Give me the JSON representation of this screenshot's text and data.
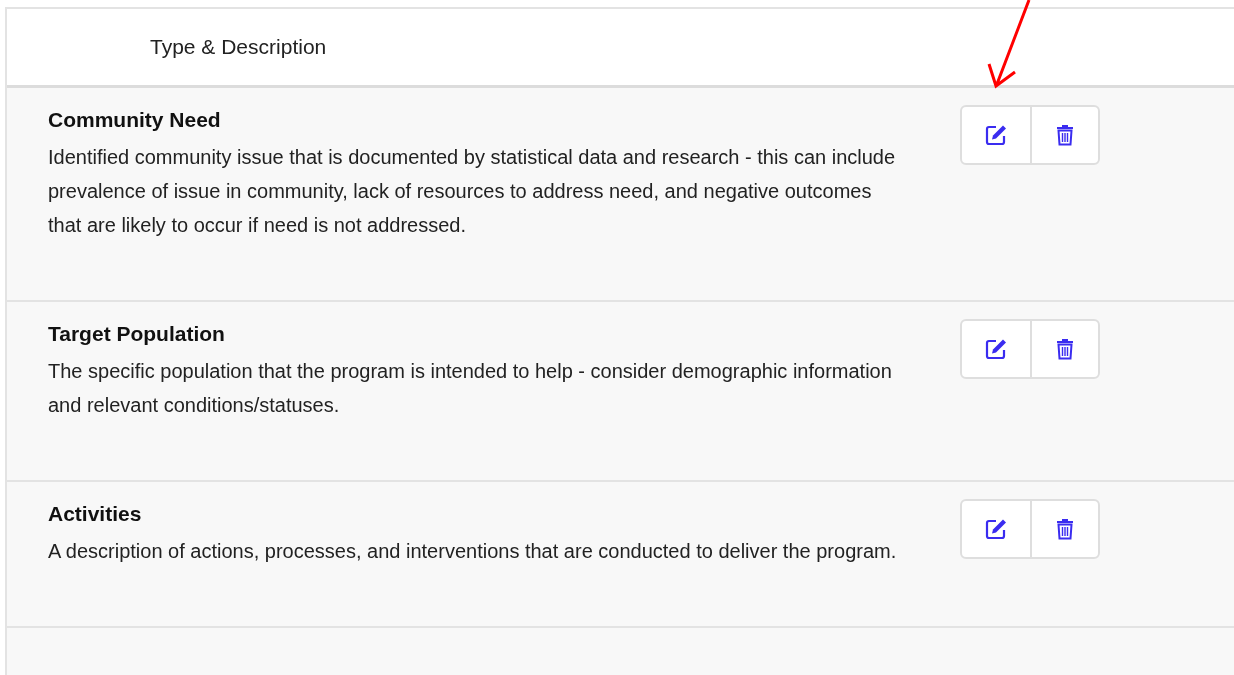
{
  "table": {
    "columns": [
      "Type & Description"
    ],
    "rows": [
      {
        "title": "Community Need",
        "description": "Identified community issue that is documented by statistical data and research - this can include prevalence of issue in community, lack of resources to address need, and negative outcomes that are likely to occur if need is not addressed."
      },
      {
        "title": "Target Population",
        "description": "The specific population that the program is intended to help - consider demographic information and relevant conditions/statuses."
      },
      {
        "title": "Activities",
        "description": "A description of actions, processes, and interventions that are conducted to deliver the program."
      }
    ]
  }
}
